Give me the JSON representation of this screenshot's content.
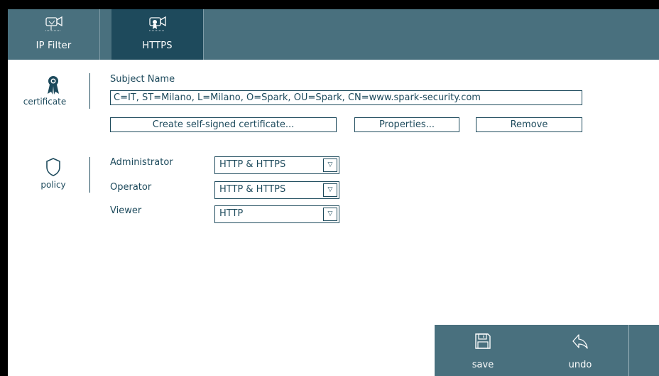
{
  "tabs": [
    {
      "label": "IP Filter",
      "icon": "camera-filter-icon",
      "active": false
    },
    {
      "label": "HTTPS",
      "icon": "camera-certificate-icon",
      "active": true
    }
  ],
  "certificate": {
    "section_label": "certificate",
    "icon": "ribbon-award-icon",
    "subject_label": "Subject Name",
    "subject_value": "C=IT, ST=Milano, L=Milano, O=Spark, OU=Spark, CN=www.spark-security.com",
    "create_button": "Create self-signed certificate...",
    "properties_button": "Properties...",
    "remove_button": "Remove"
  },
  "policy": {
    "section_label": "policy",
    "icon": "shield-icon",
    "rows": [
      {
        "label": "Administrator",
        "value": "HTTP & HTTPS"
      },
      {
        "label": "Operator",
        "value": "HTTP & HTTPS"
      },
      {
        "label": "Viewer",
        "value": "HTTP"
      }
    ],
    "dropdown_glyph": "▽"
  },
  "actions": {
    "save_label": "save",
    "undo_label": "undo"
  },
  "colors": {
    "tab_bar": "#49707e",
    "tab_active": "#1e4a5c",
    "text": "#1d4a5c"
  }
}
